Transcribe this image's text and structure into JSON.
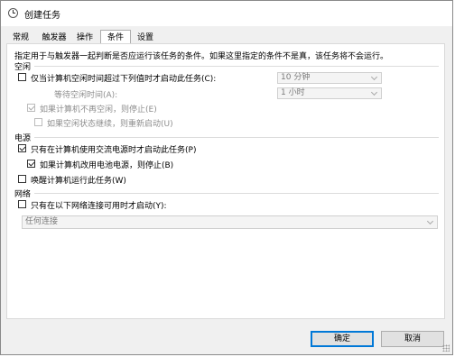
{
  "window": {
    "title": "创建任务"
  },
  "tabs": [
    {
      "label": "常规"
    },
    {
      "label": "触发器"
    },
    {
      "label": "操作"
    },
    {
      "label": "条件",
      "active": true
    },
    {
      "label": "设置"
    }
  ],
  "description": "指定用于与触发器一起判断是否应运行该任务的条件。如果这里指定的条件不是真，该任务将不会运行。",
  "idle": {
    "heading": "空闲",
    "start_only_if_idle": {
      "label": "仅当计算机空闲时间超过下列值时才启动此任务(C):",
      "checked": false
    },
    "idle_duration": {
      "value": "10 分钟"
    },
    "wait_for_idle": {
      "label": "等待空闲时间(A):",
      "value": "1 小时"
    },
    "stop_if_not_idle": {
      "label": "如果计算机不再空闲，则停止(E)",
      "checked": true
    },
    "restart_if_idle_resumes": {
      "label": "如果空闲状态继续，则重新启动(U)",
      "checked": false
    }
  },
  "power": {
    "heading": "电源",
    "ac_power_only": {
      "label": "只有在计算机使用交流电源时才启动此任务(P)",
      "checked": true
    },
    "stop_on_battery": {
      "label": "如果计算机改用电池电源，则停止(B)",
      "checked": true
    },
    "wake_to_run": {
      "label": "唤醒计算机运行此任务(W)",
      "checked": false
    }
  },
  "network": {
    "heading": "网络",
    "only_if_network": {
      "label": "只有在以下网络连接可用时才启动(Y):",
      "checked": false
    },
    "connection": {
      "value": "任何连接"
    }
  },
  "buttons": {
    "ok": "确定",
    "cancel": "取消"
  },
  "colors": {
    "accent": "#0078d7",
    "panel": "#ffffff",
    "chrome": "#f0f0f0"
  },
  "icons": {
    "title": "clock-icon",
    "checkbox_check": "checkmark-icon",
    "dropdown": "chevron-down-icon",
    "resize": "resize-grip-icon"
  }
}
